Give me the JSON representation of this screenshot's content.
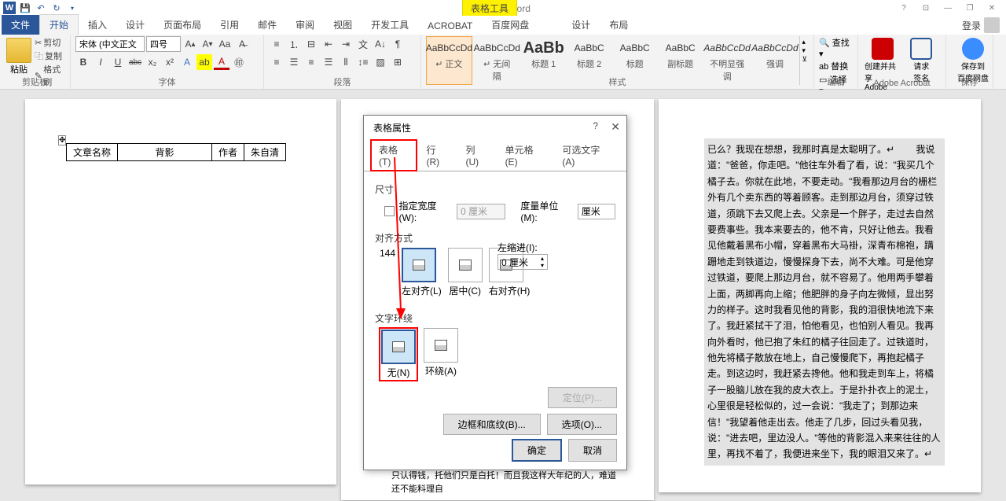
{
  "app": {
    "title": "文档2 - Word",
    "context_tool": "表格工具"
  },
  "qat": [
    "word-icon",
    "save-icon",
    "undo-icon",
    "redo-icon"
  ],
  "win": {
    "help": "?",
    "opts": "⊡",
    "min": "—",
    "restore": "❐",
    "close": "✕"
  },
  "login": {
    "label": "登录"
  },
  "tabs": {
    "file": "文件",
    "main": [
      "开始",
      "插入",
      "设计",
      "页面布局",
      "引用",
      "邮件",
      "审阅",
      "视图",
      "开发工具",
      "ACROBAT",
      "百度网盘"
    ],
    "context": [
      "设计",
      "布局"
    ],
    "active": "开始"
  },
  "ribbon": {
    "clipboard": {
      "paste": "粘贴",
      "cut": "剪切",
      "copy": "复制",
      "format_painter": "格式刷",
      "label": "剪贴板"
    },
    "font": {
      "name": "宋体 (中文正文",
      "size": "四号",
      "label": "字体",
      "bold": "B",
      "italic": "I",
      "underline": "U",
      "strike": "abc"
    },
    "paragraph": {
      "label": "段落"
    },
    "styles": {
      "label": "样式",
      "items": [
        {
          "preview": "AaBbCcDd",
          "name": "↵ 正文",
          "selected": true
        },
        {
          "preview": "AaBbCcDd",
          "name": "↵ 无间隔"
        },
        {
          "preview": "AaBb",
          "name": "标题 1",
          "big": true
        },
        {
          "preview": "AaBbC",
          "name": "标题 2"
        },
        {
          "preview": "AaBbC",
          "name": "标题"
        },
        {
          "preview": "AaBbC",
          "name": "副标题"
        },
        {
          "preview": "AaBbCcDd",
          "name": "不明显强调",
          "italic": true
        },
        {
          "preview": "AaBbCcDd",
          "name": "强调",
          "italic": true
        }
      ]
    },
    "editing": {
      "find": "查找",
      "replace": "替换",
      "select": "选择",
      "label": "编辑"
    },
    "adobe": {
      "create": "创建并共享",
      "sign": "请求",
      "pdf": "Adobe PDF",
      "sig": "签名",
      "label": "Adobe Acrobat"
    },
    "baidu": {
      "save": "保存到",
      "disk": "百度网盘",
      "label": "保存"
    }
  },
  "table": {
    "headers": [
      "文章名称",
      "背影",
      "作者",
      "朱自清"
    ]
  },
  "dialog": {
    "title": "表格属性",
    "tabs": [
      "表格(T)",
      "行(R)",
      "列(U)",
      "单元格(E)",
      "可选文字(A)"
    ],
    "size": {
      "label": "尺寸",
      "spec_width": "指定宽度(W):",
      "width_val": "0 厘米",
      "unit_label": "度量单位(M):",
      "unit_val": "厘米"
    },
    "align": {
      "label": "对齐方式",
      "items": [
        "左对齐(L)",
        "居中(C)",
        "右对齐(H)"
      ],
      "indent_label": "左缩进(I):",
      "indent_val": "0 厘米"
    },
    "wrap": {
      "label": "文字环绕",
      "items": [
        "无(N)",
        "环绕(A)"
      ]
    },
    "position_btn": "定位(P)...",
    "border_btn": "边框和底纹(B)...",
    "options_btn": "选项(O)...",
    "ok": "确定",
    "cancel": "取消"
  },
  "page3_text": "已么？我现在想想，我那时真是太聪明了。↵\n　　我说道：\"爸爸，你走吧。\"他往车外看了看，说：\"我买几个橘子去。你就在此地，不要走动。\"我看那边月台的栅栏外有几个卖东西的等着顾客。走到那边月台，须穿过铁道，须跳下去又爬上去。父亲是一个胖子，走过去自然要费事些。我本来要去的，他不肯，只好让他去。我看见他戴着黑布小帽，穿着黑布大马褂，深青布棉袍，蹒跚地走到铁道边，慢慢探身下去，尚不大难。可是他穿过铁道，要爬上那边月台，就不容易了。他用两手攀着上面，两脚再向上缩；他肥胖的身子向左微倾，显出努力的样子。这时我看见他的背影，我的泪很快地流下来了。我赶紧拭干了泪，怕他看见，也怕别人看见。我再向外看时，他已抱了朱红的橘子往回走了。过铁道时，他先将橘子散放在地上，自己慢慢爬下，再抱起橘子走。到这边时，我赶紧去搀他。他和我走到车上，将橘子一股脑儿放在我的皮大衣上。于是扑扑衣上的泥土，心里很是轻松似的，过一会说：\"我走了；到那边来信！\"我望着他走出去。他走了几步，回过头看见我，说：\"进去吧，里边没人。\"等他的背影混入来来往往的人里，再找不着了，我便进来坐下，我的眼泪又来了。↵",
  "page2_text": "要受凉。文嘱托茶房好好照应我。我心里暗笑他的迂；他们只认得钱，托他们只是白托！而且我这样大年纪的人，难道还不能料理自"
}
